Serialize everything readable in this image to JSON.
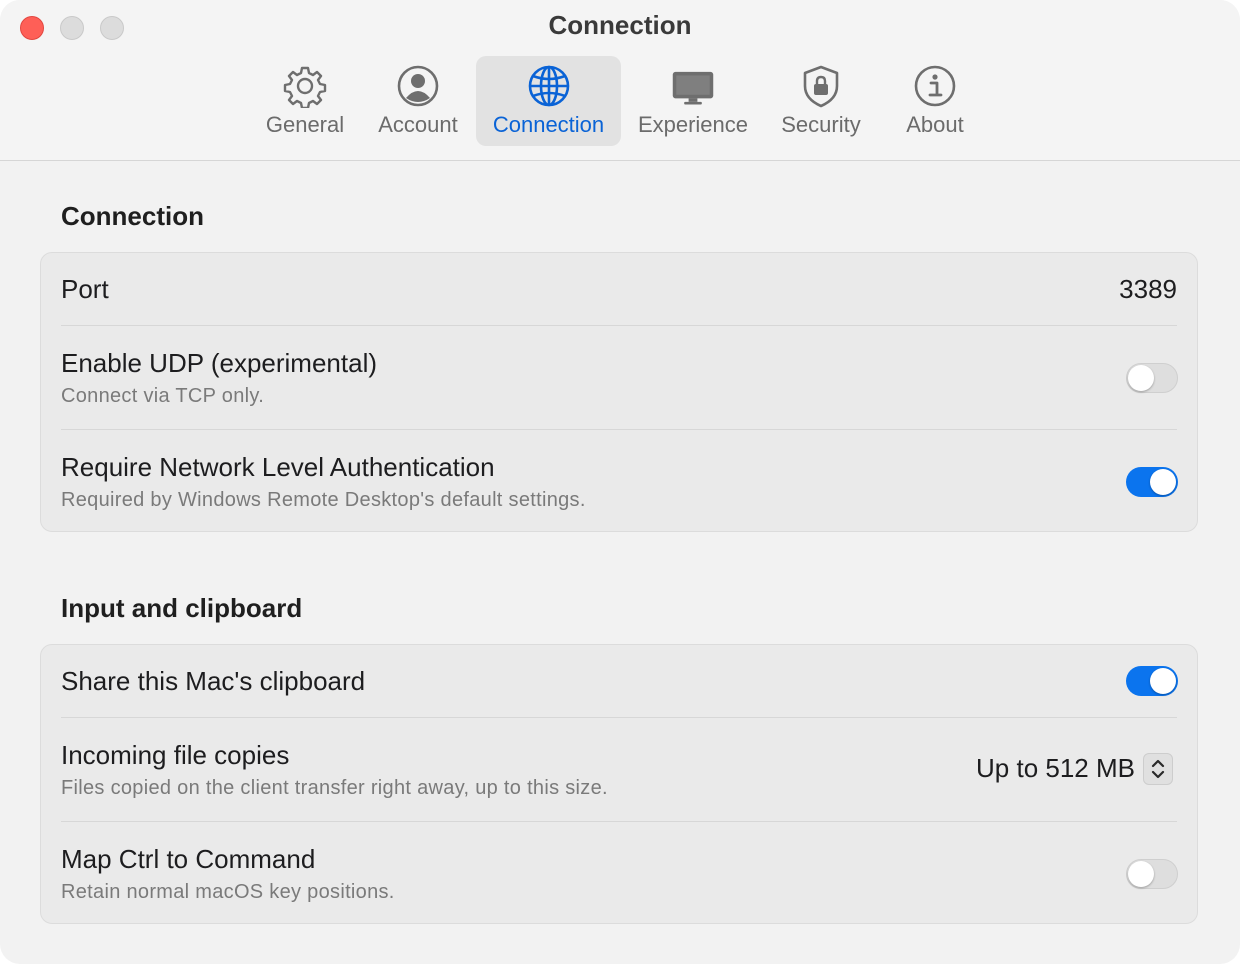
{
  "window": {
    "title": "Connection",
    "controls": [
      "close",
      "minimize",
      "zoom"
    ]
  },
  "toolbar": {
    "tabs": [
      {
        "label": "General",
        "icon": "gear-icon",
        "selected": false
      },
      {
        "label": "Account",
        "icon": "person-circle-icon",
        "selected": false
      },
      {
        "label": "Connection",
        "icon": "globe-icon",
        "selected": true
      },
      {
        "label": "Experience",
        "icon": "display-icon",
        "selected": false
      },
      {
        "label": "Security",
        "icon": "lock-shield-icon",
        "selected": false
      },
      {
        "label": "About",
        "icon": "info-circle-icon",
        "selected": false
      }
    ]
  },
  "connection": {
    "title": "Connection",
    "port": {
      "label": "Port",
      "value": "3389"
    },
    "udp": {
      "label": "Enable UDP (experimental)",
      "sub": "Connect via TCP only.",
      "enabled": false
    },
    "nla": {
      "label": "Require Network Level Authentication",
      "sub": "Required by Windows Remote Desktop's default settings.",
      "enabled": true
    }
  },
  "input": {
    "title": "Input and clipboard",
    "clipboard": {
      "label": "Share this Mac's clipboard",
      "enabled": true
    },
    "file_copies": {
      "label": "Incoming file copies",
      "sub": "Files copied on the client transfer right away, up to this size.",
      "value": "Up to 512 MB"
    },
    "map_ctrl": {
      "label": "Map Ctrl to Command",
      "sub": "Retain normal macOS key positions.",
      "enabled": false
    }
  },
  "colors": {
    "accent": "#0b74ee",
    "selected_tab_text": "#0a63d6",
    "close_button": "#fe5f57"
  }
}
